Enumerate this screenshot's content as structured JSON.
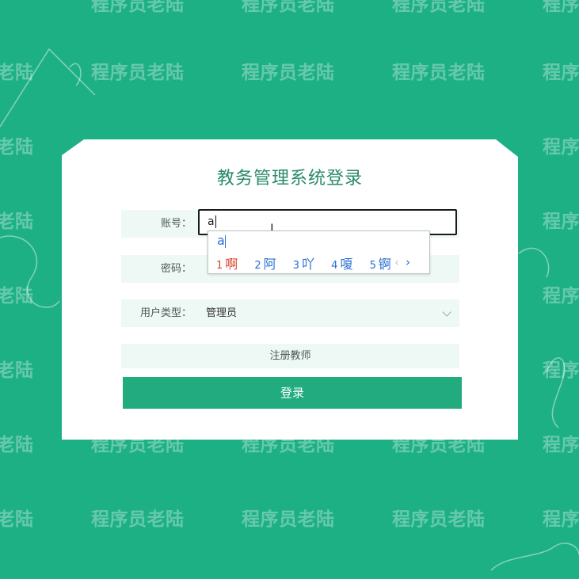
{
  "watermark": "程序员老陆",
  "login": {
    "title": "教务管理系统登录",
    "account_label": "账号：",
    "account_value": "a",
    "password_label": "密码：",
    "password_value": "·",
    "user_type_label": "用户类型：",
    "user_type_value": "管理员",
    "register_label": "注册教师",
    "login_button": "登录"
  },
  "ime": {
    "composition": "a",
    "candidates": [
      {
        "num": "1",
        "text": "啊"
      },
      {
        "num": "2",
        "text": "阿"
      },
      {
        "num": "3",
        "text": "吖"
      },
      {
        "num": "4",
        "text": "嗄"
      },
      {
        "num": "5",
        "text": "锕"
      }
    ],
    "prev": "‹",
    "next": "›"
  },
  "colors": {
    "background": "#1eb085",
    "accent": "#22ab7f",
    "title": "#2a8a6a",
    "ime_text": "#2b6fd1",
    "ime_selected": "#d9432b"
  }
}
